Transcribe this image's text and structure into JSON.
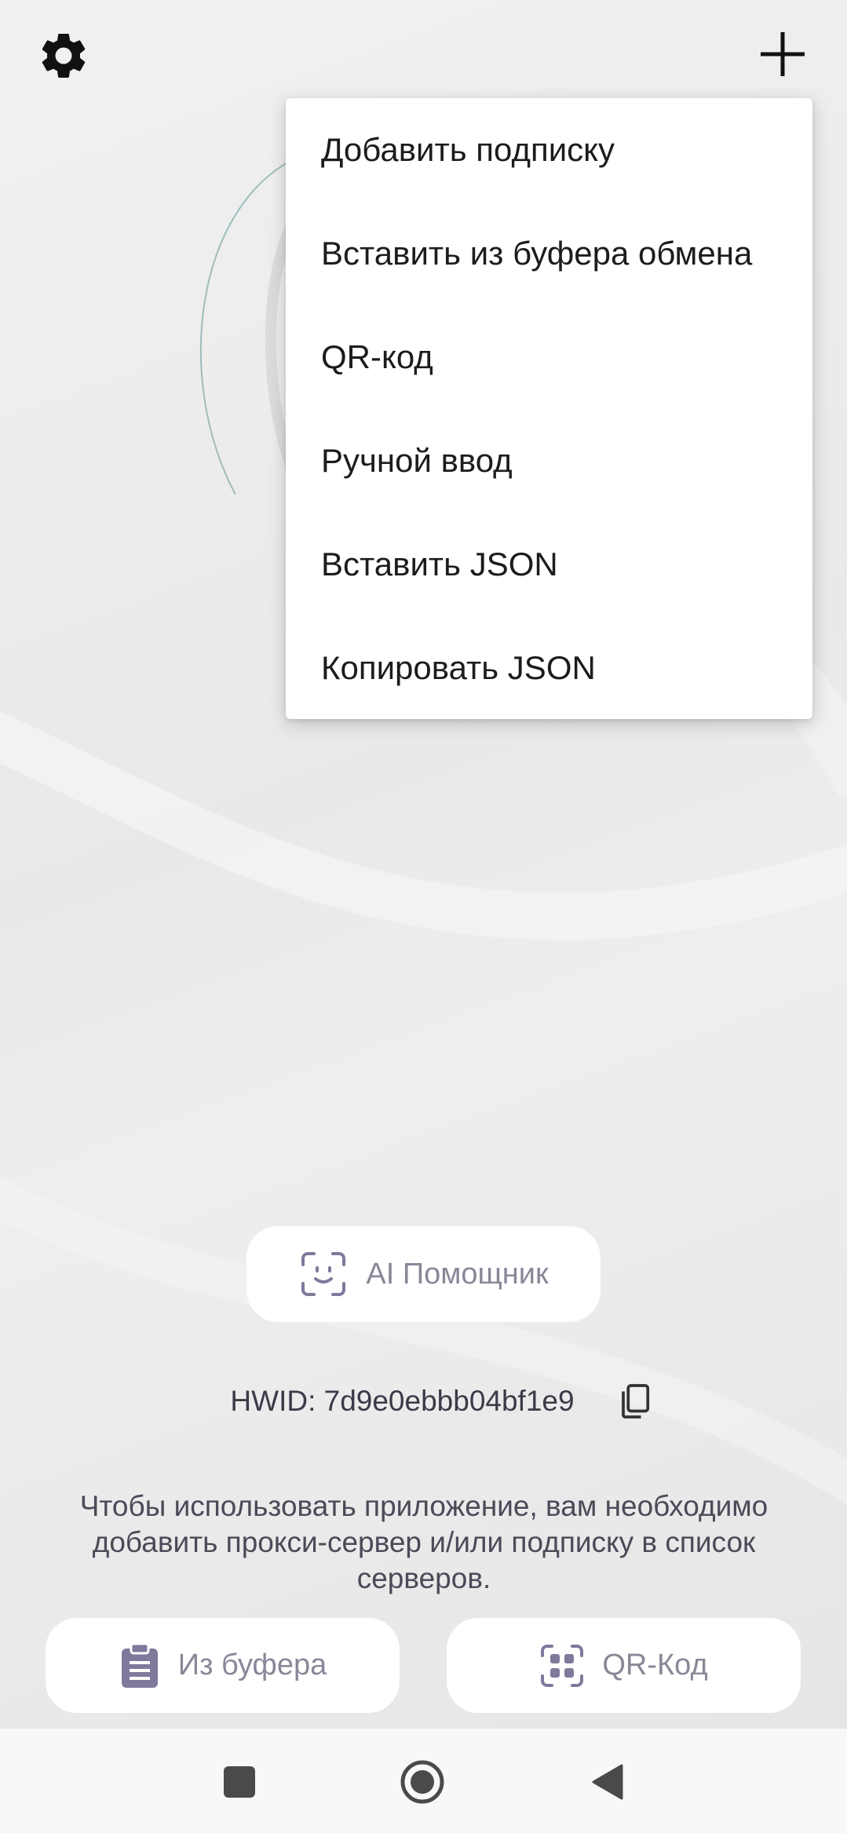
{
  "top_bar": {
    "settings_icon": "gear-icon",
    "add_icon": "plus-icon"
  },
  "menu": {
    "items": [
      {
        "label": "Добавить подписку"
      },
      {
        "label": "Вставить из буфера обмена"
      },
      {
        "label": "QR-код"
      },
      {
        "label": "Ручной ввод"
      },
      {
        "label": "Вставить JSON"
      },
      {
        "label": "Копировать JSON"
      }
    ]
  },
  "ai_button": {
    "label": "AI Помощник",
    "icon": "face-scan-icon"
  },
  "hwid": {
    "text": "HWID: 7d9e0ebbb04bf1e9",
    "icon": "copy-icon"
  },
  "hint": {
    "text": "Чтобы использовать приложение, вам необходимо добавить прокси-сервер и/или подписку в список серверов."
  },
  "bottom_buttons": {
    "clipboard_label": "Из буфера",
    "clipboard_icon": "clipboard-icon",
    "qr_label": "QR-Код",
    "qr_icon": "qr-scan-icon"
  },
  "nav": {
    "recent_icon": "square-icon",
    "home_icon": "circle-home-icon",
    "back_icon": "triangle-back-icon"
  },
  "colors": {
    "accent_icon": "#8a86ad",
    "menu_bg": "#ffffff"
  }
}
